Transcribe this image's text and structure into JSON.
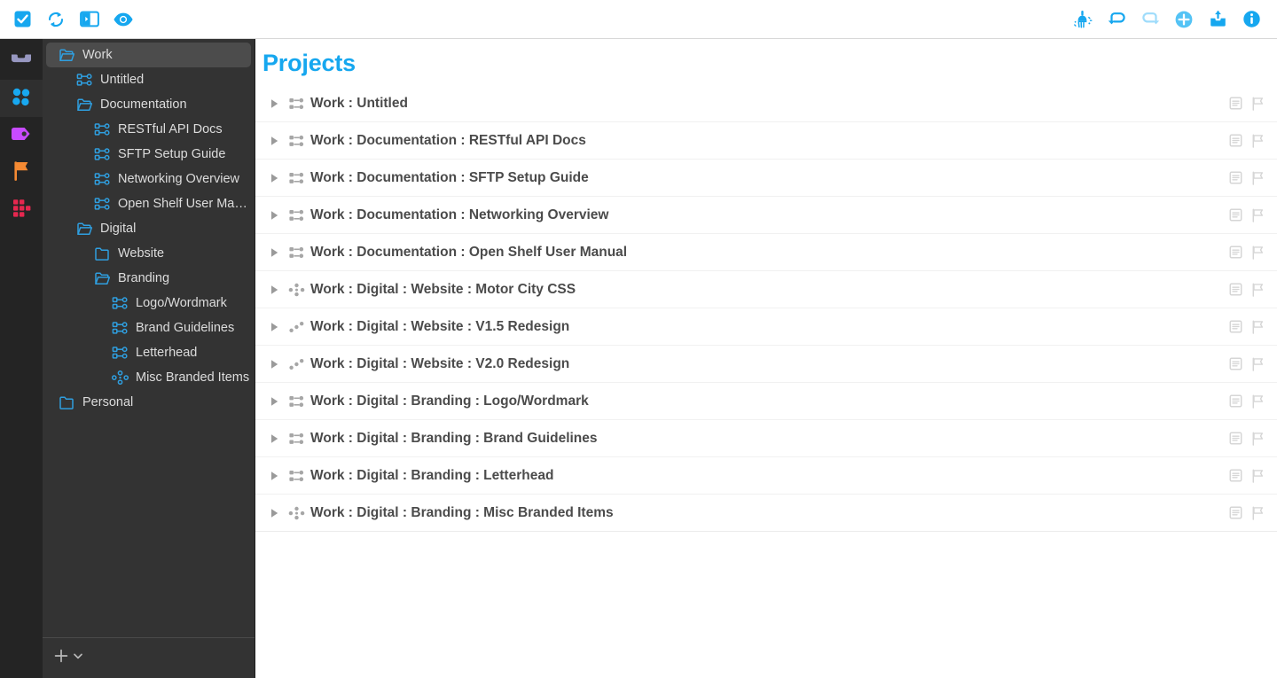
{
  "toolbar": {
    "left": [
      {
        "name": "complete-icon",
        "label": "Complete"
      },
      {
        "name": "sync-icon",
        "label": "Sync"
      },
      {
        "name": "sidebar-toggle-icon",
        "label": "Toggle Sidebar"
      },
      {
        "name": "view-options-icon",
        "label": "View"
      }
    ],
    "right": [
      {
        "name": "clean-up-icon",
        "label": "Clean Up"
      },
      {
        "name": "undo-icon",
        "label": "Undo"
      },
      {
        "name": "redo-icon",
        "label": "Redo"
      },
      {
        "name": "add-icon",
        "label": "Add"
      },
      {
        "name": "inbox-icon",
        "label": "Inbox"
      },
      {
        "name": "info-icon",
        "label": "Inspector"
      }
    ]
  },
  "rail": {
    "items": [
      {
        "name": "perspective-inbox",
        "label": "Inbox",
        "color": "#9797c0",
        "active": false
      },
      {
        "name": "perspective-projects",
        "label": "Projects",
        "color": "#18a8f0",
        "active": true
      },
      {
        "name": "perspective-tags",
        "label": "Tags",
        "color": "#c84bff",
        "active": false
      },
      {
        "name": "perspective-forecast",
        "label": "Forecast",
        "color": "#f58a33",
        "active": false
      },
      {
        "name": "perspective-review",
        "label": "Review",
        "color": "#e6274f",
        "active": false
      }
    ]
  },
  "sidebar": {
    "items": [
      {
        "label": "Work",
        "icon": "folder-open",
        "depth": 0,
        "selected": true
      },
      {
        "label": "Untitled",
        "icon": "sequential",
        "depth": 1,
        "selected": false
      },
      {
        "label": "Documentation",
        "icon": "folder-open",
        "depth": 1,
        "selected": false
      },
      {
        "label": "RESTful API Docs",
        "icon": "sequential",
        "depth": 2,
        "selected": false
      },
      {
        "label": "SFTP Setup Guide",
        "icon": "sequential",
        "depth": 2,
        "selected": false
      },
      {
        "label": "Networking Overview",
        "icon": "sequential",
        "depth": 2,
        "selected": false
      },
      {
        "label": "Open Shelf User Man…",
        "icon": "sequential",
        "depth": 2,
        "selected": false
      },
      {
        "label": "Digital",
        "icon": "folder-open",
        "depth": 1,
        "selected": false
      },
      {
        "label": "Website",
        "icon": "folder",
        "depth": 2,
        "selected": false
      },
      {
        "label": "Branding",
        "icon": "folder-open",
        "depth": 2,
        "selected": false
      },
      {
        "label": "Logo/Wordmark",
        "icon": "sequential",
        "depth": 3,
        "selected": false
      },
      {
        "label": "Brand Guidelines",
        "icon": "sequential",
        "depth": 3,
        "selected": false
      },
      {
        "label": "Letterhead",
        "icon": "sequential",
        "depth": 3,
        "selected": false
      },
      {
        "label": "Misc Branded Items",
        "icon": "parallel",
        "depth": 3,
        "selected": false
      },
      {
        "label": "Personal",
        "icon": "folder",
        "depth": 0,
        "selected": false
      }
    ],
    "footer": {
      "add_label": "+",
      "chevron_label": "v"
    }
  },
  "main": {
    "title": "Projects",
    "rows": [
      {
        "title": "Work : Untitled",
        "icon": "sequential",
        "expanded": false,
        "note": true,
        "flag": true
      },
      {
        "title": "Work : Documentation : RESTful API Docs",
        "icon": "sequential",
        "expanded": false,
        "note": true,
        "flag": true
      },
      {
        "title": "Work : Documentation : SFTP Setup Guide",
        "icon": "sequential",
        "expanded": false,
        "note": true,
        "flag": true
      },
      {
        "title": "Work : Documentation : Networking Overview",
        "icon": "sequential",
        "expanded": false,
        "note": true,
        "flag": true
      },
      {
        "title": "Work : Documentation : Open Shelf User Manual",
        "icon": "sequential",
        "expanded": false,
        "note": true,
        "flag": true
      },
      {
        "title": "Work : Digital : Website : Motor City CSS",
        "icon": "parallel",
        "expanded": false,
        "note": true,
        "flag": true
      },
      {
        "title": "Work : Digital : Website : V1.5 Redesign",
        "icon": "single",
        "expanded": false,
        "note": true,
        "flag": true
      },
      {
        "title": "Work : Digital : Website : V2.0 Redesign",
        "icon": "single",
        "expanded": false,
        "note": true,
        "flag": true
      },
      {
        "title": "Work : Digital : Branding : Logo/Wordmark",
        "icon": "sequential",
        "expanded": false,
        "note": true,
        "flag": true
      },
      {
        "title": "Work : Digital : Branding : Brand Guidelines",
        "icon": "sequential",
        "expanded": false,
        "note": true,
        "flag": true
      },
      {
        "title": "Work : Digital : Branding : Letterhead",
        "icon": "sequential",
        "expanded": false,
        "note": true,
        "flag": true
      },
      {
        "title": "Work : Digital : Branding : Misc Branded Items",
        "icon": "parallel",
        "expanded": false,
        "note": true,
        "flag": true
      }
    ]
  },
  "colors": {
    "accent": "#16a7ef",
    "sidebar_bg": "#333333",
    "rail_bg": "#242424",
    "row_text": "#4b4b4b"
  }
}
